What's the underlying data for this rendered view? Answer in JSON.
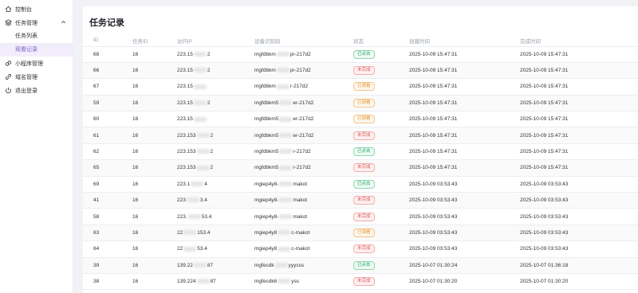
{
  "sidebar": {
    "items": [
      {
        "label": "控制台",
        "icon": "home-icon"
      },
      {
        "label": "任务管理",
        "icon": "layers-icon",
        "expanded": true,
        "children": [
          {
            "label": "任务列表",
            "active": false
          },
          {
            "label": "观看记录",
            "active": true
          }
        ]
      },
      {
        "label": "小程序管理",
        "icon": "miniprogram-icon"
      },
      {
        "label": "域名管理",
        "icon": "link-icon"
      },
      {
        "label": "退出登录",
        "icon": "power-icon"
      }
    ]
  },
  "main": {
    "title": "任务记录",
    "columns": [
      "ID",
      "任务ID",
      "访问IP",
      "设备识别码",
      "状态",
      "创建时间",
      "完成时间"
    ],
    "rows": [
      {
        "id": "68",
        "task_id": "16",
        "ip_start": "223.15",
        "ip_end": "2",
        "device_start": "mgfdbkm",
        "device_end": "pr-217d2",
        "status": "已点击",
        "status_color": "green",
        "created": "2025-10-09 15:47:31",
        "completed": "2025-10-09 15:47:31"
      },
      {
        "id": "66",
        "task_id": "16",
        "ip_start": "223.15",
        "ip_end": "2",
        "device_start": "mgfdbkm",
        "device_end": "pr-217d2",
        "status": "未完成",
        "status_color": "red",
        "created": "2025-10-09 15:47:31",
        "completed": "2025-10-09 15:47:31"
      },
      {
        "id": "67",
        "task_id": "16",
        "ip_start": "223.15",
        "ip_end": "",
        "device_start": "mgfdbkm",
        "device_end": "r-217d2",
        "status": "已观看",
        "status_color": "orange",
        "created": "2025-10-09 15:47:31",
        "completed": "2025-10-09 15:47:31"
      },
      {
        "id": "59",
        "task_id": "16",
        "ip_start": "223.15",
        "ip_end": "2",
        "device_start": "mgfdbkm5",
        "device_end": "er-217d2",
        "status": "已观看",
        "status_color": "orange",
        "created": "2025-10-09 15:47:31",
        "completed": "2025-10-09 15:47:31"
      },
      {
        "id": "60",
        "task_id": "16",
        "ip_start": "223.15",
        "ip_end": "",
        "device_start": "mgfdbkm5",
        "device_end": "er-217d2",
        "status": "已观看",
        "status_color": "orange",
        "created": "2025-10-09 15:47:31",
        "completed": "2025-10-09 15:47:31"
      },
      {
        "id": "61",
        "task_id": "16",
        "ip_start": "223.153",
        "ip_end": "2",
        "device_start": "mgfdbkm5",
        "device_end": "er-217d2",
        "status": "未完成",
        "status_color": "red",
        "created": "2025-10-09 15:47:31",
        "completed": "2025-10-09 15:47:31"
      },
      {
        "id": "62",
        "task_id": "16",
        "ip_start": "223.153",
        "ip_end": "2",
        "device_start": "mgfdbkm5",
        "device_end": "r-217d2",
        "status": "已点击",
        "status_color": "green",
        "created": "2025-10-09 15:47:31",
        "completed": "2025-10-09 15:47:31"
      },
      {
        "id": "65",
        "task_id": "16",
        "ip_start": "223.153",
        "ip_end": "2",
        "device_start": "mgfdbkm5",
        "device_end": "r-217d2",
        "status": "未完成",
        "status_color": "red",
        "created": "2025-10-09 15:47:31",
        "completed": "2025-10-09 15:47:31"
      },
      {
        "id": "69",
        "task_id": "16",
        "ip_start": "223.1",
        "ip_end": "4",
        "device_start": "mgiep4y8-",
        "device_end": "makot",
        "status": "已点击",
        "status_color": "green",
        "created": "2025-10-09 03:53:43",
        "completed": "2025-10-09 03:53:43"
      },
      {
        "id": "41",
        "task_id": "16",
        "ip_start": "223",
        "ip_end": "3.4",
        "device_start": "mgiep4y8-",
        "device_end": "makot",
        "status": "未完成",
        "status_color": "red",
        "created": "2025-10-09 03:53:43",
        "completed": "2025-10-09 03:53:43"
      },
      {
        "id": "58",
        "task_id": "16",
        "ip_start": "223.",
        "ip_end": "53.4",
        "device_start": "mgiep4y8-",
        "device_end": "makot",
        "status": "未完成",
        "status_color": "red",
        "created": "2025-10-09 03:53:43",
        "completed": "2025-10-09 03:53:43"
      },
      {
        "id": "63",
        "task_id": "16",
        "ip_start": "22",
        "ip_end": "153.4",
        "device_start": "mgiep4y8",
        "device_end": "c-makot",
        "status": "已观看",
        "status_color": "orange",
        "created": "2025-10-09 03:53:43",
        "completed": "2025-10-09 03:53:43"
      },
      {
        "id": "64",
        "task_id": "16",
        "ip_start": "22",
        "ip_end": "53.4",
        "device_start": "mgiep4y8",
        "device_end": "c-makot",
        "status": "未完成",
        "status_color": "red",
        "created": "2025-10-09 03:53:43",
        "completed": "2025-10-09 03:53:43"
      },
      {
        "id": "39",
        "task_id": "16",
        "ip_start": "139.22",
        "ip_end": "87",
        "device_start": "mgfecdk",
        "device_end": "yyysss",
        "status": "已点击",
        "status_color": "green",
        "created": "2025-10-07 01:30:24",
        "completed": "2025-10-07 01:36:18"
      },
      {
        "id": "38",
        "task_id": "16",
        "ip_start": "139.224",
        "ip_end": "87",
        "device_start": "mgfecdk6",
        "device_end": "yss",
        "status": "未完成",
        "status_color": "red",
        "created": "2025-10-07 01:30:20",
        "completed": "2025-10-07 01:30:20"
      }
    ]
  }
}
